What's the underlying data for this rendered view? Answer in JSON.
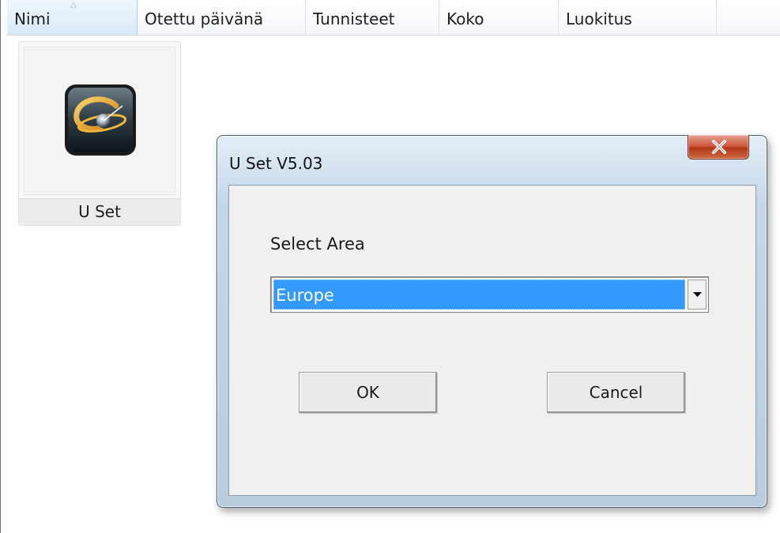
{
  "explorer": {
    "columns": [
      {
        "label": "Nimi",
        "sorted": true
      },
      {
        "label": "Otettu päivänä"
      },
      {
        "label": "Tunnisteet"
      },
      {
        "label": "Koko"
      },
      {
        "label": "Luokitus"
      },
      {
        "label": ""
      }
    ],
    "files": [
      {
        "name": "U Set",
        "icon": "u-set-app-icon"
      }
    ]
  },
  "dialog": {
    "title": "U Set V5.03",
    "close_icon": "close-x-icon",
    "select_label": "Select Area",
    "area_select": {
      "selected": "Europe",
      "dropdown_icon": "chevron-down-icon"
    },
    "ok_label": "OK",
    "cancel_label": "Cancel"
  },
  "colors": {
    "selection": "#3399ff",
    "close_button": "#c9462a",
    "dialog_frame": "#bfd3e5"
  }
}
